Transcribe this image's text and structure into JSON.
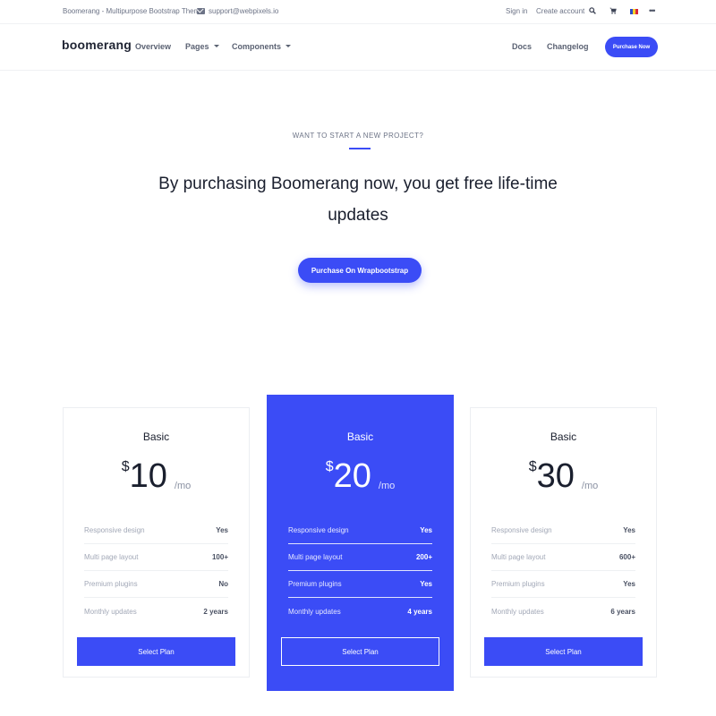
{
  "topbar": {
    "brand": "Boomerang - Multipurpose Bootstrap Theme",
    "email": "support@webpixels.io",
    "sign_in": "Sign in",
    "create_account": "Create account",
    "icons": [
      "search-icon",
      "cart-icon",
      "flag-icon",
      "more-icon"
    ],
    "search_glyph": "⚲",
    "cart_glyph": "🛒",
    "more_glyph": "•••"
  },
  "nav": {
    "logo": "boomerang",
    "overview": "Overview",
    "pages": "Pages",
    "components": "Components",
    "docs": "Docs",
    "changelog": "Changelog",
    "purchase_now": "Purchase Now"
  },
  "hero": {
    "eyebrow": "WANT TO START A NEW PROJECT?",
    "title": "By purchasing Boomerang now, you get free life-time updates",
    "button": "Purchase On Wrapbootstrap"
  },
  "plans": [
    {
      "name": "Basic",
      "currency": "$",
      "amount": "10",
      "period": "/mo",
      "features": [
        {
          "label": "Responsive design",
          "value": "Yes"
        },
        {
          "label": "Multi page layout",
          "value": "100+"
        },
        {
          "label": "Premium plugins",
          "value": "No"
        },
        {
          "label": "Monthly updates",
          "value": "2 years"
        }
      ],
      "button": "Select Plan"
    },
    {
      "name": "Basic",
      "currency": "$",
      "amount": "20",
      "period": "/mo",
      "features": [
        {
          "label": "Responsive design",
          "value": "Yes"
        },
        {
          "label": "Multi page layout",
          "value": "200+"
        },
        {
          "label": "Premium plugins",
          "value": "Yes"
        },
        {
          "label": "Monthly updates",
          "value": "4 years"
        }
      ],
      "button": "Select Plan"
    },
    {
      "name": "Basic",
      "currency": "$",
      "amount": "30",
      "period": "/mo",
      "features": [
        {
          "label": "Responsive design",
          "value": "Yes"
        },
        {
          "label": "Multi page layout",
          "value": "600+"
        },
        {
          "label": "Premium plugins",
          "value": "Yes"
        },
        {
          "label": "Monthly updates",
          "value": "6 years"
        }
      ],
      "button": "Select Plan"
    }
  ],
  "colors": {
    "accent": "#3b4cf6",
    "text": "#1a1f2e",
    "muted": "#6c7386"
  }
}
